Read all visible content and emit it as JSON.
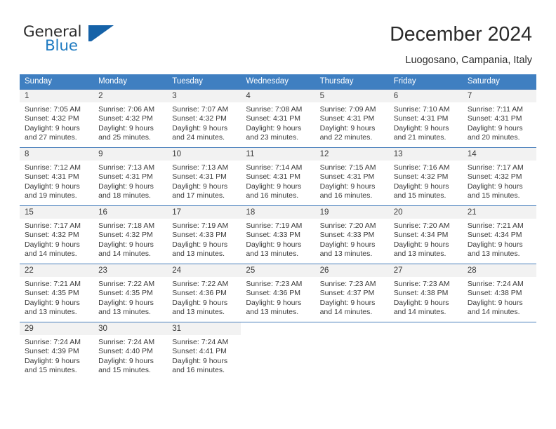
{
  "logo": {
    "word_one": "General",
    "word_two": "Blue",
    "mark_name": "blue-triangle-logo-mark",
    "color_dark": "#2b2b2b",
    "color_blue": "#1f7bc1"
  },
  "header": {
    "title": "December 2024",
    "subtitle": "Luogosano, Campania, Italy"
  },
  "theme": {
    "header_row_bg": "#3f7fc1",
    "header_row_text": "#ffffff",
    "daynum_bg": "#f2f2f2",
    "grid_line": "#4a80bc",
    "body_text": "#3a3a3a"
  },
  "weekday_headers": [
    "Sunday",
    "Monday",
    "Tuesday",
    "Wednesday",
    "Thursday",
    "Friday",
    "Saturday"
  ],
  "weeks": [
    [
      {
        "day": "1",
        "sunrise": "Sunrise: 7:05 AM",
        "sunset": "Sunset: 4:32 PM",
        "daylight1": "Daylight: 9 hours",
        "daylight2": "and 27 minutes."
      },
      {
        "day": "2",
        "sunrise": "Sunrise: 7:06 AM",
        "sunset": "Sunset: 4:32 PM",
        "daylight1": "Daylight: 9 hours",
        "daylight2": "and 25 minutes."
      },
      {
        "day": "3",
        "sunrise": "Sunrise: 7:07 AM",
        "sunset": "Sunset: 4:32 PM",
        "daylight1": "Daylight: 9 hours",
        "daylight2": "and 24 minutes."
      },
      {
        "day": "4",
        "sunrise": "Sunrise: 7:08 AM",
        "sunset": "Sunset: 4:31 PM",
        "daylight1": "Daylight: 9 hours",
        "daylight2": "and 23 minutes."
      },
      {
        "day": "5",
        "sunrise": "Sunrise: 7:09 AM",
        "sunset": "Sunset: 4:31 PM",
        "daylight1": "Daylight: 9 hours",
        "daylight2": "and 22 minutes."
      },
      {
        "day": "6",
        "sunrise": "Sunrise: 7:10 AM",
        "sunset": "Sunset: 4:31 PM",
        "daylight1": "Daylight: 9 hours",
        "daylight2": "and 21 minutes."
      },
      {
        "day": "7",
        "sunrise": "Sunrise: 7:11 AM",
        "sunset": "Sunset: 4:31 PM",
        "daylight1": "Daylight: 9 hours",
        "daylight2": "and 20 minutes."
      }
    ],
    [
      {
        "day": "8",
        "sunrise": "Sunrise: 7:12 AM",
        "sunset": "Sunset: 4:31 PM",
        "daylight1": "Daylight: 9 hours",
        "daylight2": "and 19 minutes."
      },
      {
        "day": "9",
        "sunrise": "Sunrise: 7:13 AM",
        "sunset": "Sunset: 4:31 PM",
        "daylight1": "Daylight: 9 hours",
        "daylight2": "and 18 minutes."
      },
      {
        "day": "10",
        "sunrise": "Sunrise: 7:13 AM",
        "sunset": "Sunset: 4:31 PM",
        "daylight1": "Daylight: 9 hours",
        "daylight2": "and 17 minutes."
      },
      {
        "day": "11",
        "sunrise": "Sunrise: 7:14 AM",
        "sunset": "Sunset: 4:31 PM",
        "daylight1": "Daylight: 9 hours",
        "daylight2": "and 16 minutes."
      },
      {
        "day": "12",
        "sunrise": "Sunrise: 7:15 AM",
        "sunset": "Sunset: 4:31 PM",
        "daylight1": "Daylight: 9 hours",
        "daylight2": "and 16 minutes."
      },
      {
        "day": "13",
        "sunrise": "Sunrise: 7:16 AM",
        "sunset": "Sunset: 4:32 PM",
        "daylight1": "Daylight: 9 hours",
        "daylight2": "and 15 minutes."
      },
      {
        "day": "14",
        "sunrise": "Sunrise: 7:17 AM",
        "sunset": "Sunset: 4:32 PM",
        "daylight1": "Daylight: 9 hours",
        "daylight2": "and 15 minutes."
      }
    ],
    [
      {
        "day": "15",
        "sunrise": "Sunrise: 7:17 AM",
        "sunset": "Sunset: 4:32 PM",
        "daylight1": "Daylight: 9 hours",
        "daylight2": "and 14 minutes."
      },
      {
        "day": "16",
        "sunrise": "Sunrise: 7:18 AM",
        "sunset": "Sunset: 4:32 PM",
        "daylight1": "Daylight: 9 hours",
        "daylight2": "and 14 minutes."
      },
      {
        "day": "17",
        "sunrise": "Sunrise: 7:19 AM",
        "sunset": "Sunset: 4:33 PM",
        "daylight1": "Daylight: 9 hours",
        "daylight2": "and 13 minutes."
      },
      {
        "day": "18",
        "sunrise": "Sunrise: 7:19 AM",
        "sunset": "Sunset: 4:33 PM",
        "daylight1": "Daylight: 9 hours",
        "daylight2": "and 13 minutes."
      },
      {
        "day": "19",
        "sunrise": "Sunrise: 7:20 AM",
        "sunset": "Sunset: 4:33 PM",
        "daylight1": "Daylight: 9 hours",
        "daylight2": "and 13 minutes."
      },
      {
        "day": "20",
        "sunrise": "Sunrise: 7:20 AM",
        "sunset": "Sunset: 4:34 PM",
        "daylight1": "Daylight: 9 hours",
        "daylight2": "and 13 minutes."
      },
      {
        "day": "21",
        "sunrise": "Sunrise: 7:21 AM",
        "sunset": "Sunset: 4:34 PM",
        "daylight1": "Daylight: 9 hours",
        "daylight2": "and 13 minutes."
      }
    ],
    [
      {
        "day": "22",
        "sunrise": "Sunrise: 7:21 AM",
        "sunset": "Sunset: 4:35 PM",
        "daylight1": "Daylight: 9 hours",
        "daylight2": "and 13 minutes."
      },
      {
        "day": "23",
        "sunrise": "Sunrise: 7:22 AM",
        "sunset": "Sunset: 4:35 PM",
        "daylight1": "Daylight: 9 hours",
        "daylight2": "and 13 minutes."
      },
      {
        "day": "24",
        "sunrise": "Sunrise: 7:22 AM",
        "sunset": "Sunset: 4:36 PM",
        "daylight1": "Daylight: 9 hours",
        "daylight2": "and 13 minutes."
      },
      {
        "day": "25",
        "sunrise": "Sunrise: 7:23 AM",
        "sunset": "Sunset: 4:36 PM",
        "daylight1": "Daylight: 9 hours",
        "daylight2": "and 13 minutes."
      },
      {
        "day": "26",
        "sunrise": "Sunrise: 7:23 AM",
        "sunset": "Sunset: 4:37 PM",
        "daylight1": "Daylight: 9 hours",
        "daylight2": "and 14 minutes."
      },
      {
        "day": "27",
        "sunrise": "Sunrise: 7:23 AM",
        "sunset": "Sunset: 4:38 PM",
        "daylight1": "Daylight: 9 hours",
        "daylight2": "and 14 minutes."
      },
      {
        "day": "28",
        "sunrise": "Sunrise: 7:24 AM",
        "sunset": "Sunset: 4:38 PM",
        "daylight1": "Daylight: 9 hours",
        "daylight2": "and 14 minutes."
      }
    ],
    [
      {
        "day": "29",
        "sunrise": "Sunrise: 7:24 AM",
        "sunset": "Sunset: 4:39 PM",
        "daylight1": "Daylight: 9 hours",
        "daylight2": "and 15 minutes."
      },
      {
        "day": "30",
        "sunrise": "Sunrise: 7:24 AM",
        "sunset": "Sunset: 4:40 PM",
        "daylight1": "Daylight: 9 hours",
        "daylight2": "and 15 minutes."
      },
      {
        "day": "31",
        "sunrise": "Sunrise: 7:24 AM",
        "sunset": "Sunset: 4:41 PM",
        "daylight1": "Daylight: 9 hours",
        "daylight2": "and 16 minutes."
      },
      {
        "day": "",
        "sunrise": "",
        "sunset": "",
        "daylight1": "",
        "daylight2": ""
      },
      {
        "day": "",
        "sunrise": "",
        "sunset": "",
        "daylight1": "",
        "daylight2": ""
      },
      {
        "day": "",
        "sunrise": "",
        "sunset": "",
        "daylight1": "",
        "daylight2": ""
      },
      {
        "day": "",
        "sunrise": "",
        "sunset": "",
        "daylight1": "",
        "daylight2": ""
      }
    ]
  ]
}
